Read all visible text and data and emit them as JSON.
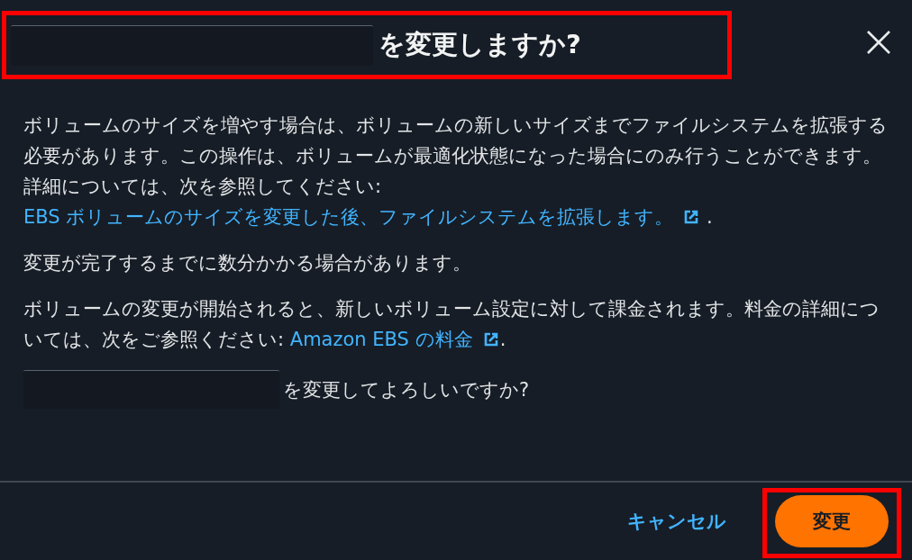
{
  "dialog": {
    "title": {
      "redacted": true,
      "text": "を変更しますか?",
      "highlighted": true
    },
    "paragraphs": [
      {
        "text": "ボリュームのサイズを増やす場合は、ボリュームの新しいサイズまでファイルシステムを拡張する必要があります。この操作は、ボリュームが最適化状態になった場合にのみ行うことができます。詳細については、次を参照してください: ",
        "link": "EBS ボリュームのサイズを変更した後、ファイルシステムを拡張します。",
        "external": true,
        "end": " ."
      },
      {
        "text": "変更が完了するまでに数分かかる場合があります。"
      },
      {
        "text": "ボリュームの変更が開始されると、新しいボリューム設定に対して課金されます。料金の詳細については、次をご参照ください: ",
        "link": "Amazon EBS の料金",
        "external": true,
        "end": "."
      }
    ],
    "confirm": {
      "redacted": true,
      "text": "を変更してよろしいですか?"
    },
    "buttons": [
      {
        "label": "キャンセル",
        "kind": "link",
        "highlighted": false
      },
      {
        "label": "変更",
        "kind": "primary",
        "highlighted": true
      }
    ]
  }
}
